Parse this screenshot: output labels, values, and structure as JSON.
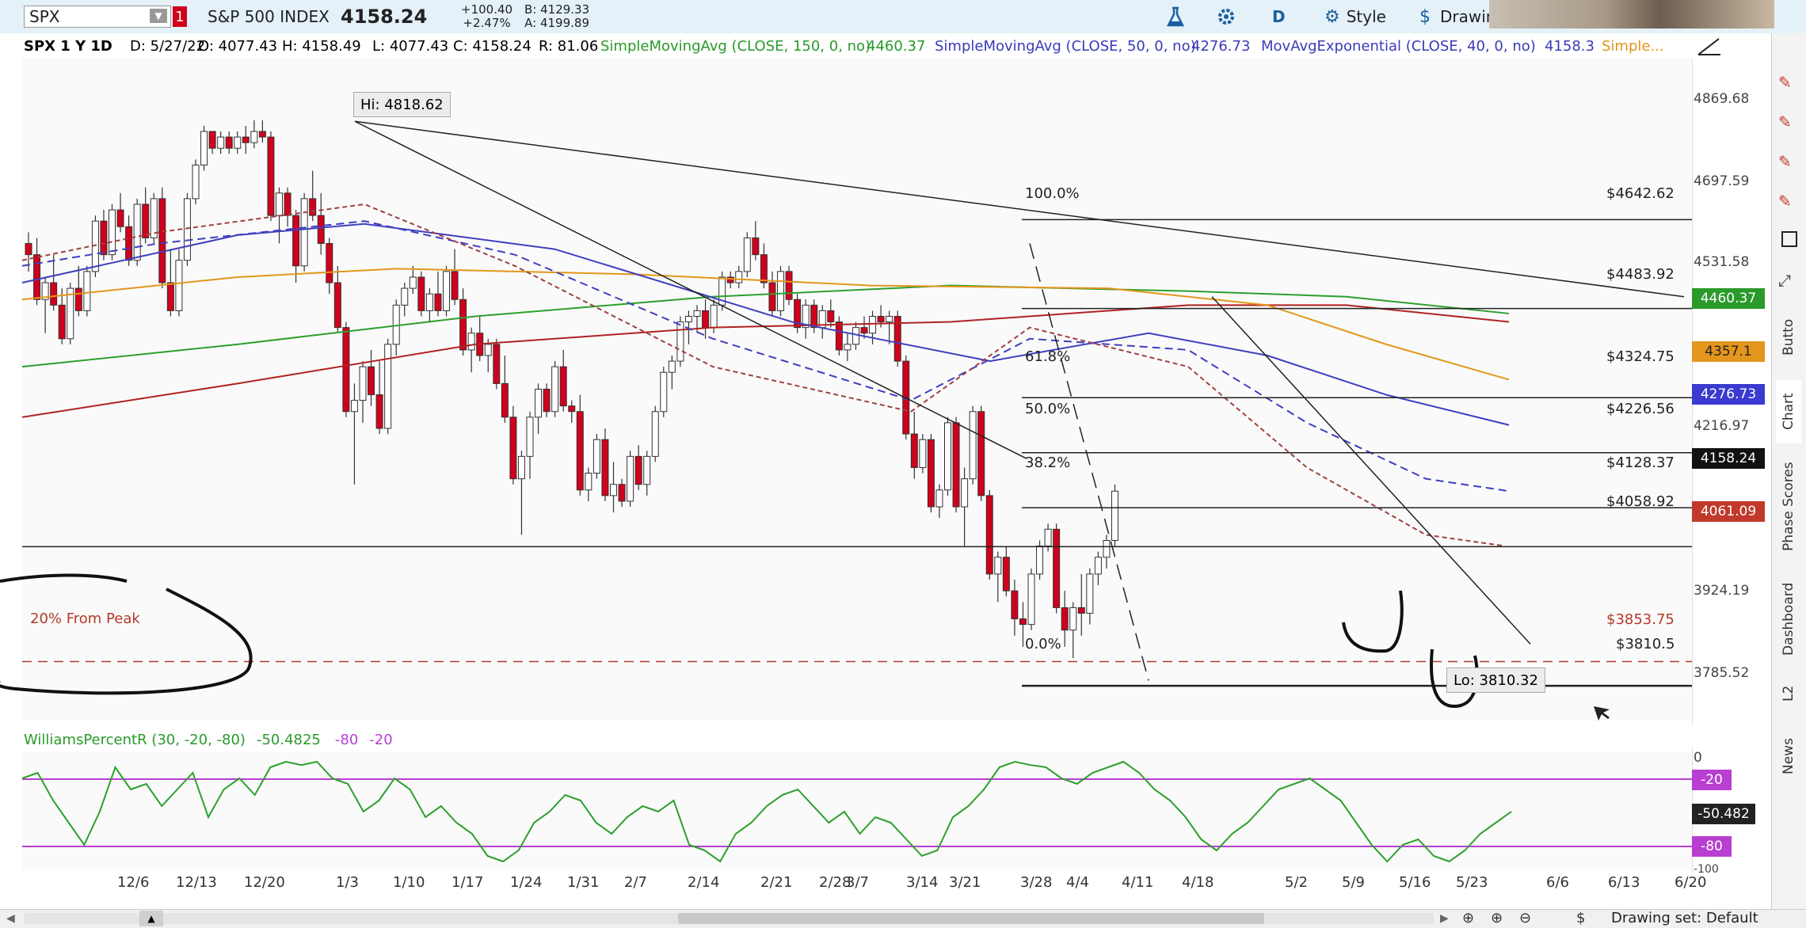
{
  "toolbar": {
    "symbol": "SPX",
    "alert_badge": "1",
    "name": "S&P 500 INDEX",
    "last": "4158.24",
    "change": "+100.40",
    "change_pct": "+2.47%",
    "bid": "B: 4129.33",
    "ask": "A: 4199.89",
    "aggregation": "D",
    "style_label": "Style",
    "drawings_label": "Drawin"
  },
  "study_bar": {
    "symbol_period": "SPX 1 Y 1D",
    "date": "D: 5/27/22",
    "open": "O: 4077.43",
    "high": "H: 4158.49",
    "low": "L: 4077.43",
    "close": "C: 4158.24",
    "range": "R: 81.06",
    "sma150": "SimpleMovingAvg (CLOSE, 150, 0, no)",
    "sma150_val": "4460.37",
    "sma50": "SimpleMovingAvg (CLOSE, 50, 0, no)",
    "sma50_val": "4276.73",
    "ema40": "MovAvgExponential (CLOSE, 40, 0, no)",
    "ema40_val": "4158.3",
    "more": "Simple..."
  },
  "annotations": {
    "high": "Hi: 4818.62",
    "low": "Lo: 3810.32",
    "from_peak": "20% From Peak"
  },
  "fib": {
    "p100": "100.0%",
    "p618": "61.8%",
    "p50": "50.0%",
    "p382": "38.2%",
    "p0": "0.0%",
    "v4642": "$4642.62",
    "v4483": "$4483.92",
    "v4324": "$4324.75",
    "v4226": "$4226.56",
    "v4128": "$4128.37",
    "v4058": "$4058.92",
    "v3853": "$3853.75",
    "v3810": "$3810.5"
  },
  "price_axis": [
    "4869.68",
    "4697.59",
    "4531.58",
    "4216.97",
    "3924.19",
    "3785.52"
  ],
  "price_tags": {
    "t4460": "4460.37",
    "t4357": "4357.1",
    "t4276": "4276.73",
    "t4158": "4158.24",
    "t4061": "4061.09"
  },
  "x_labels": [
    "12/6",
    "12/13",
    "12/20",
    "1/3",
    "1/10",
    "1/17",
    "1/24",
    "1/31",
    "2/7",
    "2/14",
    "2/21",
    "2/28",
    "3/7",
    "3/14",
    "3/21",
    "3/28",
    "4/4",
    "4/11",
    "4/18",
    "5/2",
    "5/9",
    "5/16",
    "5/23",
    "6/6",
    "6/13",
    "6/20"
  ],
  "williams": {
    "label": "WilliamsPercentR (30, -20, -80)",
    "value": "-50.4825",
    "lvl1": "-80",
    "lvl2": "-20",
    "axis_top": "0",
    "axis_bottom": "-100",
    "tag_m20": "-20",
    "tag_val": "-50.482",
    "tag_m80": "-80"
  },
  "side_tabs": [
    "Butto",
    "Chart",
    "Phase Scores",
    "Dashboard",
    "L2",
    "News"
  ],
  "bottom": {
    "drawing_set": "Drawing set: Default"
  },
  "colors": {
    "up": "#ffffff",
    "down": "#d0021b",
    "sma150": "#2ca02c",
    "sma50": "#3f3fbf",
    "ema40": "#e3961c",
    "ema200": "#b22222",
    "williams": "#2ca02c",
    "level": "#b83fd1"
  },
  "chart_data": {
    "type": "candlestick",
    "ylim": [
      3740,
      4930
    ],
    "high": 4818.62,
    "low": 3810.32,
    "fib_levels": [
      4642.62,
      4483.92,
      4324.75,
      4226.56,
      4128.37,
      3810.5
    ],
    "horizontal_levels": [
      4058.92,
      3853.75
    ],
    "candles": [
      [
        4600,
        4620,
        4550,
        4580
      ],
      [
        4580,
        4610,
        4490,
        4500
      ],
      [
        4500,
        4540,
        4440,
        4530
      ],
      [
        4530,
        4580,
        4480,
        4490
      ],
      [
        4490,
        4520,
        4420,
        4430
      ],
      [
        4430,
        4530,
        4420,
        4520
      ],
      [
        4520,
        4560,
        4470,
        4480
      ],
      [
        4480,
        4560,
        4470,
        4550
      ],
      [
        4550,
        4650,
        4540,
        4640
      ],
      [
        4640,
        4660,
        4570,
        4580
      ],
      [
        4580,
        4670,
        4570,
        4660
      ],
      [
        4660,
        4690,
        4620,
        4630
      ],
      [
        4630,
        4650,
        4560,
        4570
      ],
      [
        4570,
        4680,
        4560,
        4670
      ],
      [
        4670,
        4700,
        4600,
        4610
      ],
      [
        4610,
        4690,
        4600,
        4680
      ],
      [
        4680,
        4700,
        4520,
        4530
      ],
      [
        4530,
        4590,
        4470,
        4480
      ],
      [
        4480,
        4590,
        4470,
        4570
      ],
      [
        4570,
        4690,
        4560,
        4680
      ],
      [
        4680,
        4750,
        4670,
        4740
      ],
      [
        4740,
        4810,
        4730,
        4800
      ],
      [
        4800,
        4800,
        4760,
        4770
      ],
      [
        4770,
        4800,
        4760,
        4790
      ],
      [
        4790,
        4800,
        4760,
        4770
      ],
      [
        4770,
        4800,
        4760,
        4790
      ],
      [
        4790,
        4810,
        4760,
        4780
      ],
      [
        4780,
        4820,
        4770,
        4800
      ],
      [
        4800,
        4820,
        4780,
        4790
      ],
      [
        4790,
        4800,
        4640,
        4650
      ],
      [
        4650,
        4700,
        4600,
        4690
      ],
      [
        4690,
        4700,
        4630,
        4650
      ],
      [
        4650,
        4660,
        4530,
        4560
      ],
      [
        4560,
        4690,
        4550,
        4680
      ],
      [
        4680,
        4730,
        4640,
        4650
      ],
      [
        4650,
        4690,
        4580,
        4600
      ],
      [
        4600,
        4610,
        4510,
        4530
      ],
      [
        4530,
        4560,
        4440,
        4450
      ],
      [
        4450,
        4460,
        4290,
        4300
      ],
      [
        4300,
        4350,
        4170,
        4320
      ],
      [
        4320,
        4390,
        4280,
        4380
      ],
      [
        4380,
        4410,
        4310,
        4330
      ],
      [
        4330,
        4390,
        4260,
        4270
      ],
      [
        4270,
        4430,
        4260,
        4420
      ],
      [
        4420,
        4500,
        4400,
        4490
      ],
      [
        4490,
        4530,
        4470,
        4520
      ],
      [
        4520,
        4560,
        4510,
        4540
      ],
      [
        4540,
        4550,
        4470,
        4480
      ],
      [
        4480,
        4520,
        4460,
        4510
      ],
      [
        4510,
        4550,
        4470,
        4480
      ],
      [
        4480,
        4560,
        4470,
        4550
      ],
      [
        4550,
        4590,
        4490,
        4500
      ],
      [
        4500,
        4520,
        4400,
        4410
      ],
      [
        4410,
        4450,
        4370,
        4440
      ],
      [
        4440,
        4470,
        4390,
        4400
      ],
      [
        4400,
        4430,
        4370,
        4420
      ],
      [
        4420,
        4430,
        4340,
        4350
      ],
      [
        4350,
        4400,
        4280,
        4290
      ],
      [
        4290,
        4310,
        4170,
        4180
      ],
      [
        4180,
        4230,
        4080,
        4220
      ],
      [
        4220,
        4300,
        4180,
        4290
      ],
      [
        4290,
        4350,
        4260,
        4340
      ],
      [
        4340,
        4350,
        4290,
        4300
      ],
      [
        4300,
        4390,
        4290,
        4380
      ],
      [
        4380,
        4410,
        4300,
        4310
      ],
      [
        4310,
        4320,
        4280,
        4300
      ],
      [
        4300,
        4330,
        4150,
        4160
      ],
      [
        4160,
        4200,
        4140,
        4190
      ],
      [
        4190,
        4260,
        4180,
        4250
      ],
      [
        4250,
        4270,
        4140,
        4150
      ],
      [
        4150,
        4210,
        4120,
        4170
      ],
      [
        4170,
        4180,
        4130,
        4140
      ],
      [
        4140,
        4230,
        4130,
        4220
      ],
      [
        4220,
        4240,
        4160,
        4170
      ],
      [
        4170,
        4230,
        4150,
        4220
      ],
      [
        4220,
        4310,
        4210,
        4300
      ],
      [
        4300,
        4380,
        4290,
        4370
      ],
      [
        4370,
        4400,
        4340,
        4390
      ],
      [
        4390,
        4470,
        4380,
        4460
      ],
      [
        4460,
        4480,
        4420,
        4470
      ],
      [
        4470,
        4490,
        4440,
        4480
      ],
      [
        4480,
        4500,
        4430,
        4450
      ],
      [
        4450,
        4500,
        4440,
        4490
      ],
      [
        4490,
        4550,
        4480,
        4540
      ],
      [
        4540,
        4550,
        4520,
        4530
      ],
      [
        4530,
        4560,
        4520,
        4550
      ],
      [
        4550,
        4620,
        4540,
        4610
      ],
      [
        4610,
        4640,
        4570,
        4580
      ],
      [
        4580,
        4600,
        4520,
        4530
      ],
      [
        4530,
        4550,
        4470,
        4480
      ],
      [
        4480,
        4560,
        4470,
        4550
      ],
      [
        4550,
        4560,
        4490,
        4500
      ],
      [
        4500,
        4510,
        4440,
        4450
      ],
      [
        4450,
        4500,
        4430,
        4490
      ],
      [
        4490,
        4500,
        4440,
        4450
      ],
      [
        4450,
        4490,
        4430,
        4480
      ],
      [
        4480,
        4500,
        4450,
        4460
      ],
      [
        4460,
        4470,
        4400,
        4410
      ],
      [
        4410,
        4440,
        4390,
        4420
      ],
      [
        4420,
        4460,
        4410,
        4450
      ],
      [
        4450,
        4470,
        4430,
        4440
      ],
      [
        4440,
        4480,
        4420,
        4470
      ],
      [
        4470,
        4490,
        4450,
        4460
      ],
      [
        4460,
        4480,
        4420,
        4470
      ],
      [
        4470,
        4480,
        4380,
        4390
      ],
      [
        4390,
        4400,
        4250,
        4260
      ],
      [
        4260,
        4300,
        4180,
        4200
      ],
      [
        4200,
        4260,
        4190,
        4250
      ],
      [
        4250,
        4260,
        4120,
        4130
      ],
      [
        4130,
        4170,
        4110,
        4160
      ],
      [
        4160,
        4290,
        4150,
        4280
      ],
      [
        4280,
        4290,
        4120,
        4130
      ],
      [
        4130,
        4200,
        4060,
        4180
      ],
      [
        4180,
        4310,
        4170,
        4300
      ],
      [
        4300,
        4310,
        4140,
        4150
      ],
      [
        4150,
        4160,
        4000,
        4010
      ],
      [
        4010,
        4050,
        3960,
        4040
      ],
      [
        4040,
        4060,
        3970,
        3980
      ],
      [
        3980,
        4000,
        3900,
        3930
      ],
      [
        3930,
        3960,
        3880,
        3920
      ],
      [
        3920,
        4020,
        3910,
        4010
      ],
      [
        4010,
        4070,
        4000,
        4060
      ],
      [
        4060,
        4100,
        4050,
        4090
      ],
      [
        4090,
        4100,
        3940,
        3950
      ],
      [
        3950,
        3980,
        3880,
        3910
      ],
      [
        3910,
        3960,
        3860,
        3950
      ],
      [
        3950,
        4010,
        3900,
        3940
      ],
      [
        3940,
        4020,
        3920,
        4010
      ],
      [
        4010,
        4050,
        3990,
        4040
      ],
      [
        4040,
        4080,
        4020,
        4070
      ],
      [
        4070,
        4170,
        4060,
        4158
      ]
    ],
    "williams_percent_r": [
      -20,
      -15,
      -40,
      -60,
      -80,
      -50,
      -10,
      -30,
      -25,
      -45,
      -30,
      -15,
      -55,
      -30,
      -20,
      -35,
      -10,
      -5,
      -8,
      -5,
      -20,
      -25,
      -50,
      -40,
      -20,
      -30,
      -55,
      -45,
      -60,
      -70,
      -90,
      -95,
      -85,
      -60,
      -50,
      -35,
      -40,
      -60,
      -70,
      -55,
      -45,
      -50,
      -40,
      -80,
      -85,
      -95,
      -70,
      -60,
      -45,
      -35,
      -30,
      -45,
      -60,
      -50,
      -70,
      -55,
      -60,
      -75,
      -90,
      -85,
      -55,
      -45,
      -30,
      -10,
      -5,
      -8,
      -10,
      -20,
      -25,
      -15,
      -10,
      -5,
      -15,
      -30,
      -40,
      -55,
      -75,
      -85,
      -70,
      -60,
      -45,
      -30,
      -25,
      -20,
      -30,
      -40,
      -60,
      -80,
      -95,
      -80,
      -75,
      -90,
      -95,
      -85,
      -70,
      -60,
      -50
    ]
  }
}
